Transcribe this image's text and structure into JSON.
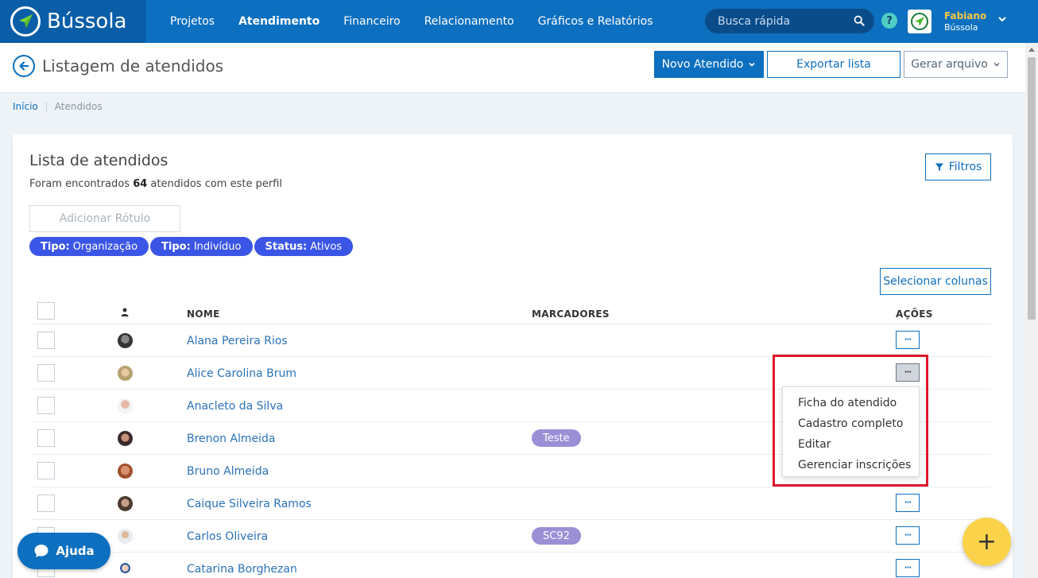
{
  "brand": {
    "name": "Bússola"
  },
  "nav": [
    {
      "label": "Projetos",
      "active": false
    },
    {
      "label": "Atendimento",
      "active": true
    },
    {
      "label": "Financeiro",
      "active": false
    },
    {
      "label": "Relacionamento",
      "active": false
    },
    {
      "label": "Gráficos e Relatórios",
      "active": false
    }
  ],
  "search": {
    "placeholder": "Busca rápida"
  },
  "help_label": "?",
  "user": {
    "name": "Fabiano",
    "org": "Bússola"
  },
  "header": {
    "title": "Listagem de atendidos",
    "new_button": "Novo Atendido",
    "export_button": "Exportar lista",
    "generate_button": "Gerar arquivo"
  },
  "breadcrumb": {
    "home": "Início",
    "current": "Atendidos"
  },
  "card": {
    "title": "Lista de atendidos",
    "sub_prefix": "Foram encontrados",
    "count": "64",
    "sub_suffix": "atendidos com este perfil",
    "filter_button": "Filtros",
    "label_button": "Adicionar Rótulo",
    "chips": [
      {
        "key": "Tipo:",
        "value": "Organização"
      },
      {
        "key": "Tipo:",
        "value": "Indivíduo"
      },
      {
        "key": "Status:",
        "value": "Ativos"
      }
    ],
    "columns_button": "Selecionar colunas"
  },
  "table": {
    "headers": {
      "name": "NOME",
      "tags": "MARCADORES",
      "actions": "AÇÕES"
    },
    "rows": [
      {
        "name": "Alana Pereira Rios",
        "tag": ""
      },
      {
        "name": "Alice Carolina Brum",
        "tag": ""
      },
      {
        "name": "Anacleto da Silva",
        "tag": ""
      },
      {
        "name": "Brenon Almeida",
        "tag": "Teste"
      },
      {
        "name": "Bruno Almeida",
        "tag": ""
      },
      {
        "name": "Caique Silveira Ramos",
        "tag": ""
      },
      {
        "name": "Carlos Oliveira",
        "tag": "SC92"
      },
      {
        "name": "Catarina Borghezan",
        "tag": ""
      }
    ],
    "actions_label": "···"
  },
  "menu": {
    "items": [
      "Ficha do atendido",
      "Cadastro completo",
      "Editar",
      "Gerenciar inscrições"
    ]
  },
  "help_fab": "Ajuda",
  "add_fab": "+",
  "colors": {
    "primary": "#0d6fbf",
    "chip": "#3b55e6",
    "tag": "#9b8fd6",
    "fab": "#fbd34a",
    "highlight": "#e0162b"
  }
}
